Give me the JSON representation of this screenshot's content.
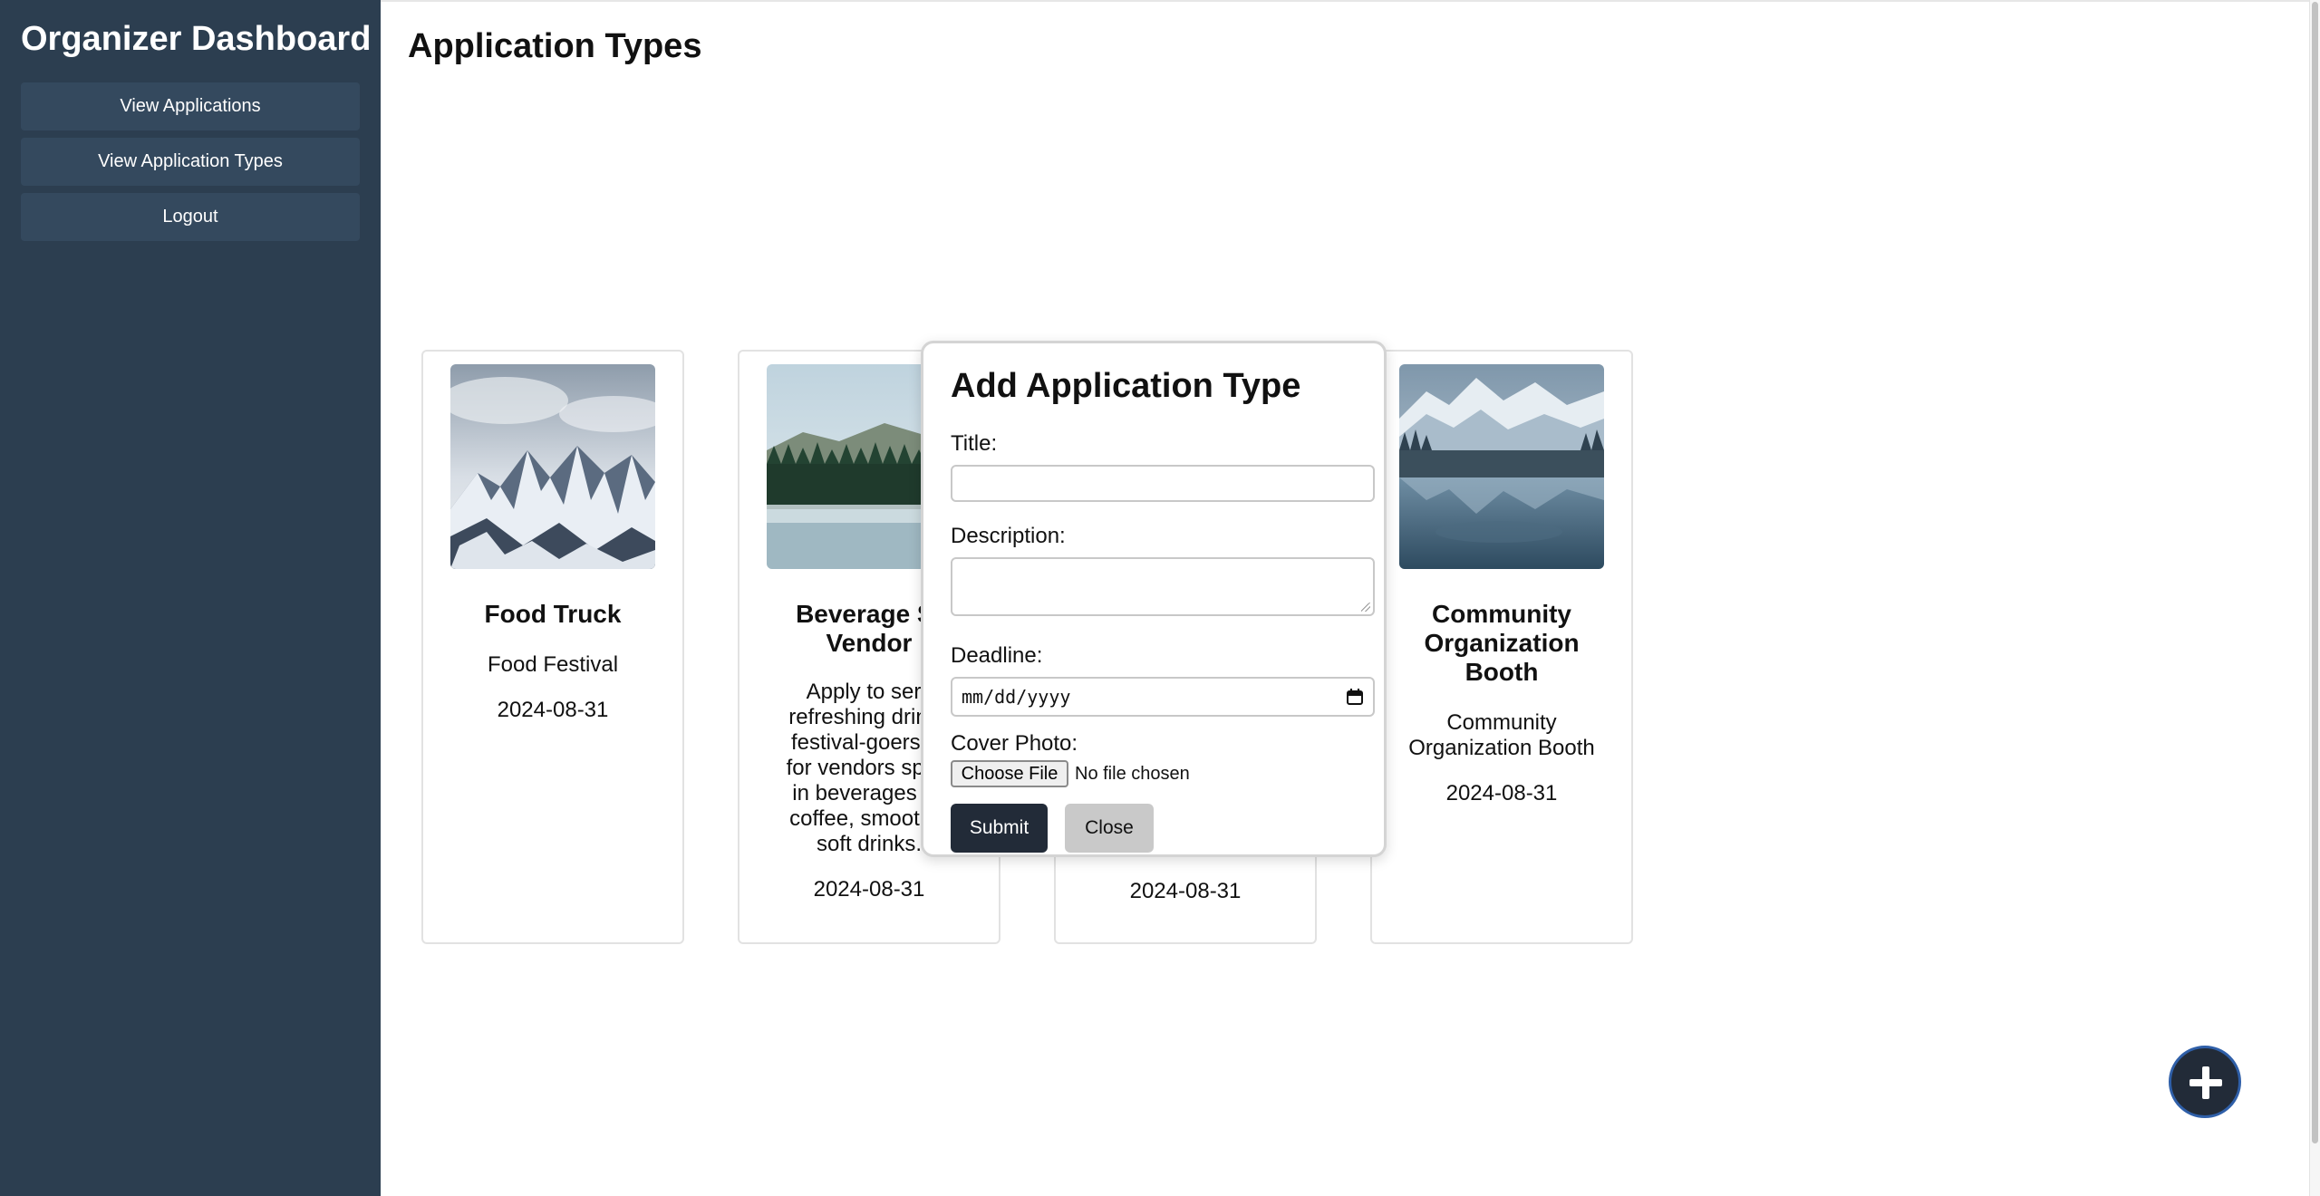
{
  "sidebar": {
    "title": "Organizer Dashboard",
    "items": [
      {
        "label": "View Applications"
      },
      {
        "label": "View Application Types"
      },
      {
        "label": "Logout"
      }
    ]
  },
  "main": {
    "title": "Application Types",
    "cards": [
      {
        "title": "Food Truck",
        "subtitle": "Food Festival",
        "date": "2024-08-31",
        "image": "snowy-mountain-peaks-photo"
      },
      {
        "title": "Beverage St\nVendor",
        "description": "Apply to serv\nrefreshing drinks\nfestival-goers. P\nfor vendors speci\nin beverages su\ncoffee, smoothie\nsoft drinks.",
        "date": "2024-08-31",
        "image": "misty-forest-lake-photo"
      },
      {
        "date": "2024-08-31"
      },
      {
        "title": "Community Organization Booth",
        "subtitle": "Community Organization Booth",
        "date": "2024-08-31",
        "image": "snowy-lake-reflection-photo"
      }
    ]
  },
  "modal": {
    "title": "Add Application Type",
    "title_label": "Title:",
    "description_label": "Description:",
    "deadline_label": "Deadline:",
    "deadline_placeholder": "mm/dd/yyyy",
    "cover_label": "Cover Photo:",
    "choose_file": "Choose File",
    "file_status": "No file chosen",
    "submit": "Submit",
    "close": "Close"
  },
  "fab": {
    "icon": "plus-icon"
  },
  "colors": {
    "sidebar_bg": "#2c3e50",
    "nav_button_bg": "#34495e",
    "primary_dark": "#222b38",
    "close_button_bg": "#c9c9c9"
  }
}
